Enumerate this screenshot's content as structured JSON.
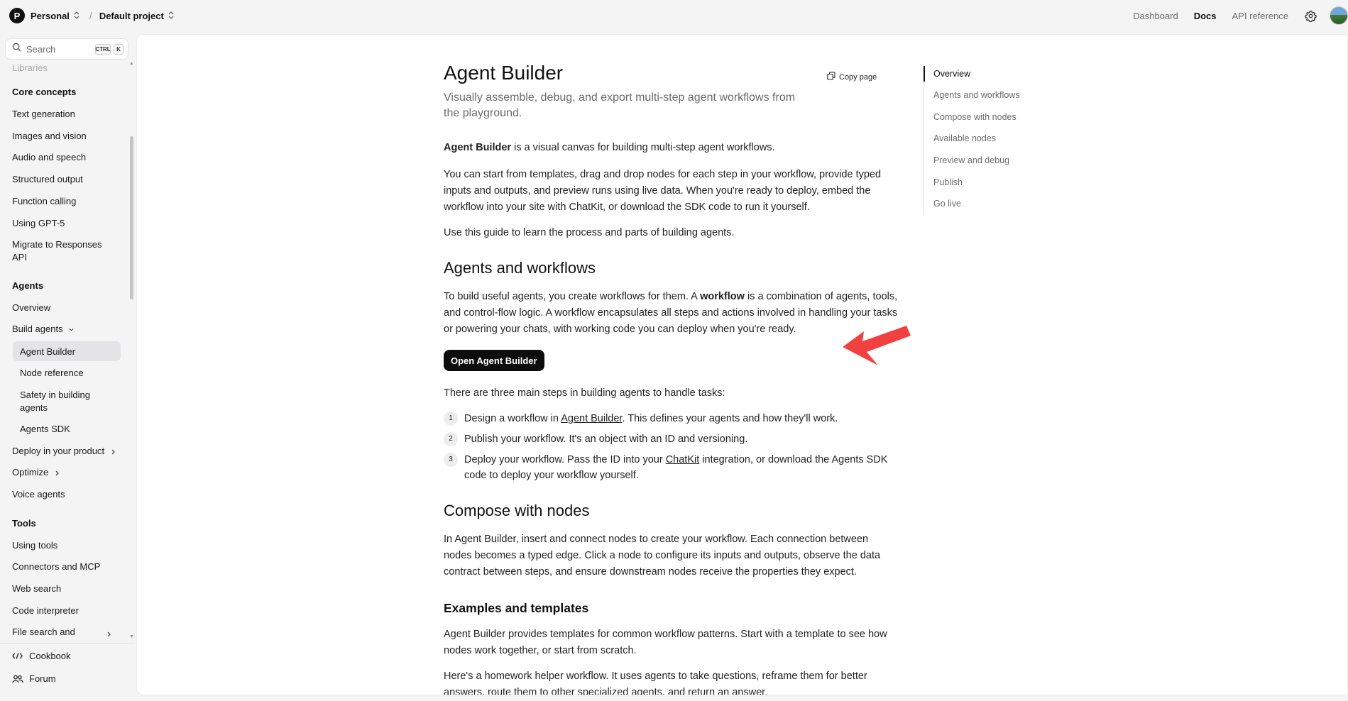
{
  "topbar": {
    "org_initial": "P",
    "org_name": "Personal",
    "project_name": "Default project",
    "nav": {
      "dashboard": "Dashboard",
      "docs": "Docs",
      "api_reference": "API reference"
    }
  },
  "sidebar": {
    "search_placeholder": "Search",
    "shortcut_ctrl": "CTRL",
    "shortcut_key": "K",
    "cut_off_item": "Libraries",
    "core_concepts": {
      "heading": "Core concepts",
      "items": [
        "Text generation",
        "Images and vision",
        "Audio and speech",
        "Structured output",
        "Function calling",
        "Using GPT-5",
        "Migrate to Responses",
        "API"
      ]
    },
    "agents": {
      "heading": "Agents",
      "overview": "Overview",
      "build_agents": "Build agents",
      "sub_items": [
        "Agent Builder",
        "Node reference",
        "Safety in building",
        "agents",
        "Agents SDK"
      ],
      "deploy": "Deploy in your product",
      "optimize": "Optimize",
      "voice": "Voice agents"
    },
    "tools": {
      "heading": "Tools",
      "items": [
        "Using tools",
        "Connectors and MCP",
        "Web search",
        "Code interpreter",
        "File search and"
      ]
    },
    "footer": {
      "cookbook": "Cookbook",
      "forum": "Forum"
    }
  },
  "page": {
    "title": "Agent Builder",
    "subtitle": "Visually assemble, debug, and export multi-step agent workflows from the playground.",
    "copy_page": "Copy page",
    "intro_bold": "Agent Builder",
    "intro_rest": " is a visual canvas for building multi-step agent workflows.",
    "para2": "You can start from templates, drag and drop nodes for each step in your workflow, provide typed inputs and outputs, and preview runs using live data. When you're ready to deploy, embed the workflow into your site with ChatKit, or download the SDK code to run it yourself.",
    "para3": "Use this guide to learn the process and parts of building agents.",
    "h_agents_workflows": "Agents and workflows",
    "aw_pre": "To build useful agents, you create workflows for them. A ",
    "aw_bold": "workflow",
    "aw_post": " is a combination of agents, tools, and control-flow logic. A workflow encapsulates all steps and actions involved in handling your tasks or powering your chats, with working code you can deploy when you're ready.",
    "open_button": "Open Agent Builder",
    "steps_intro": "There are three main steps in building agents to handle tasks:",
    "steps": [
      {
        "num": "1",
        "pre": "Design a workflow in ",
        "link": "Agent Builder",
        "post": ". This defines your agents and how they'll work."
      },
      {
        "num": "2",
        "pre": "Publish your workflow. It's an object with an ID and versioning.",
        "link": "",
        "post": ""
      },
      {
        "num": "3",
        "pre": "Deploy your workflow. Pass the ID into your ",
        "link": "ChatKit",
        "post": " integration, or download the Agents SDK code to deploy your workflow yourself."
      }
    ],
    "h_compose": "Compose with nodes",
    "compose_para": "In Agent Builder, insert and connect nodes to create your workflow. Each connection between nodes becomes a typed edge. Click a node to configure its inputs and outputs, observe the data contract between steps, and ensure downstream nodes receive the properties they expect.",
    "h_examples": "Examples and templates",
    "examples_para": "Agent Builder provides templates for common workflow patterns. Start with a template to see how nodes work together, or start from scratch.",
    "homework_para": "Here's a homework helper workflow. It uses agents to take questions, reframe them for better answers, route them to other specialized agents, and return an answer."
  },
  "toc": {
    "items": [
      "Overview",
      "Agents and workflows",
      "Compose with nodes",
      "Available nodes",
      "Preview and debug",
      "Publish",
      "Go live"
    ]
  },
  "colors": {
    "annotation_arrow": "#f04040",
    "button_bg": "#0d0d0d"
  }
}
